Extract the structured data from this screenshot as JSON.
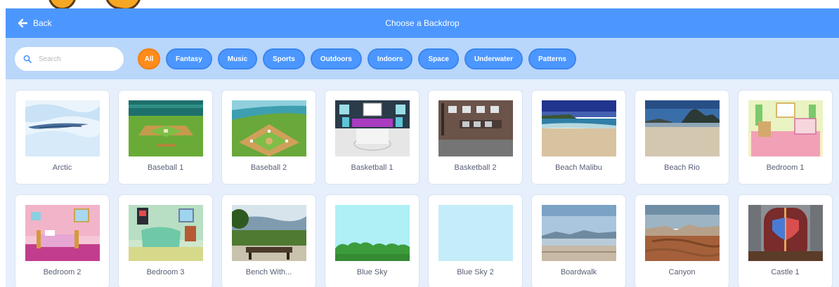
{
  "topbar": {
    "back_label": "Back",
    "title": "Choose a Backdrop"
  },
  "search": {
    "placeholder": "Search"
  },
  "filters": [
    "All",
    "Fantasy",
    "Music",
    "Sports",
    "Outdoors",
    "Indoors",
    "Space",
    "Underwater",
    "Patterns"
  ],
  "active_filter": "All",
  "backdrops": [
    {
      "name": "Arctic",
      "icon": "arctic-thumbnail"
    },
    {
      "name": "Baseball 1",
      "icon": "baseball-field-thumbnail"
    },
    {
      "name": "Baseball 2",
      "icon": "baseball-diamond-thumbnail"
    },
    {
      "name": "Basketball 1",
      "icon": "basketball-court-thumbnail"
    },
    {
      "name": "Basketball 2",
      "icon": "brick-wall-court-thumbnail"
    },
    {
      "name": "Beach Malibu",
      "icon": "beach-photo-thumbnail"
    },
    {
      "name": "Beach Rio",
      "icon": "beach-mountain-thumbnail"
    },
    {
      "name": "Bedroom 1",
      "icon": "bedroom-pink-thumbnail"
    },
    {
      "name": "Bedroom 2",
      "icon": "bedroom-bed-thumbnail"
    },
    {
      "name": "Bedroom 3",
      "icon": "bedroom-green-thumbnail"
    },
    {
      "name": "Bench With...",
      "icon": "bench-landscape-thumbnail"
    },
    {
      "name": "Blue Sky",
      "icon": "blue-sky-hills-thumbnail"
    },
    {
      "name": "Blue Sky 2",
      "icon": "blue-sky-plain-thumbnail"
    },
    {
      "name": "Boardwalk",
      "icon": "boardwalk-thumbnail"
    },
    {
      "name": "Canyon",
      "icon": "canyon-thumbnail"
    },
    {
      "name": "Castle 1",
      "icon": "castle-door-thumbnail"
    }
  ],
  "colors": {
    "header": "#4c97ff",
    "filter_bar": "#b9d6fb",
    "active_chip": "#ff8c1a",
    "library_bg": "#e6effb",
    "label_text": "#575e75"
  }
}
